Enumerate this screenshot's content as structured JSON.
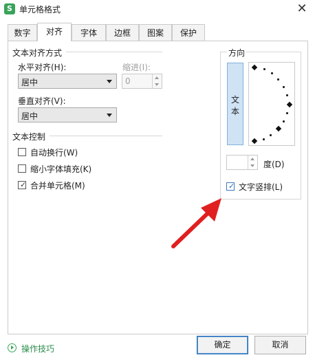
{
  "window": {
    "title": "单元格格式",
    "app_icon_letter": "S",
    "close_glyph": "✕"
  },
  "tabs": [
    {
      "label": "数字",
      "active": false
    },
    {
      "label": "对齐",
      "active": true
    },
    {
      "label": "字体",
      "active": false
    },
    {
      "label": "边框",
      "active": false
    },
    {
      "label": "图案",
      "active": false
    },
    {
      "label": "保护",
      "active": false
    }
  ],
  "text_alignment": {
    "group_title": "文本对齐方式",
    "horizontal_label": "水平对齐(H):",
    "horizontal_value": "居中",
    "indent_label": "缩进(I):",
    "indent_value": "0",
    "vertical_label": "垂直对齐(V):",
    "vertical_value": "居中"
  },
  "text_control": {
    "group_title": "文本控制",
    "options": [
      {
        "label": "自动换行(W)",
        "checked": false
      },
      {
        "label": "缩小字体填充(K)",
        "checked": false
      },
      {
        "label": "合并单元格(M)",
        "checked": true
      }
    ]
  },
  "orientation": {
    "group_title": "方向",
    "vertical_text_chars": [
      "文",
      "本"
    ],
    "degree_value": "",
    "degree_label": "度(D)",
    "vertical_layout_label": "文字竖排(L)",
    "vertical_layout_checked": true
  },
  "footer": {
    "tips_link": "操作技巧",
    "ok_label": "确定",
    "cancel_label": "取消"
  },
  "colors": {
    "accent_green": "#3aa35a",
    "annotation_arrow": "#e02020",
    "vertical_text_bg": "#cfe3f5"
  }
}
